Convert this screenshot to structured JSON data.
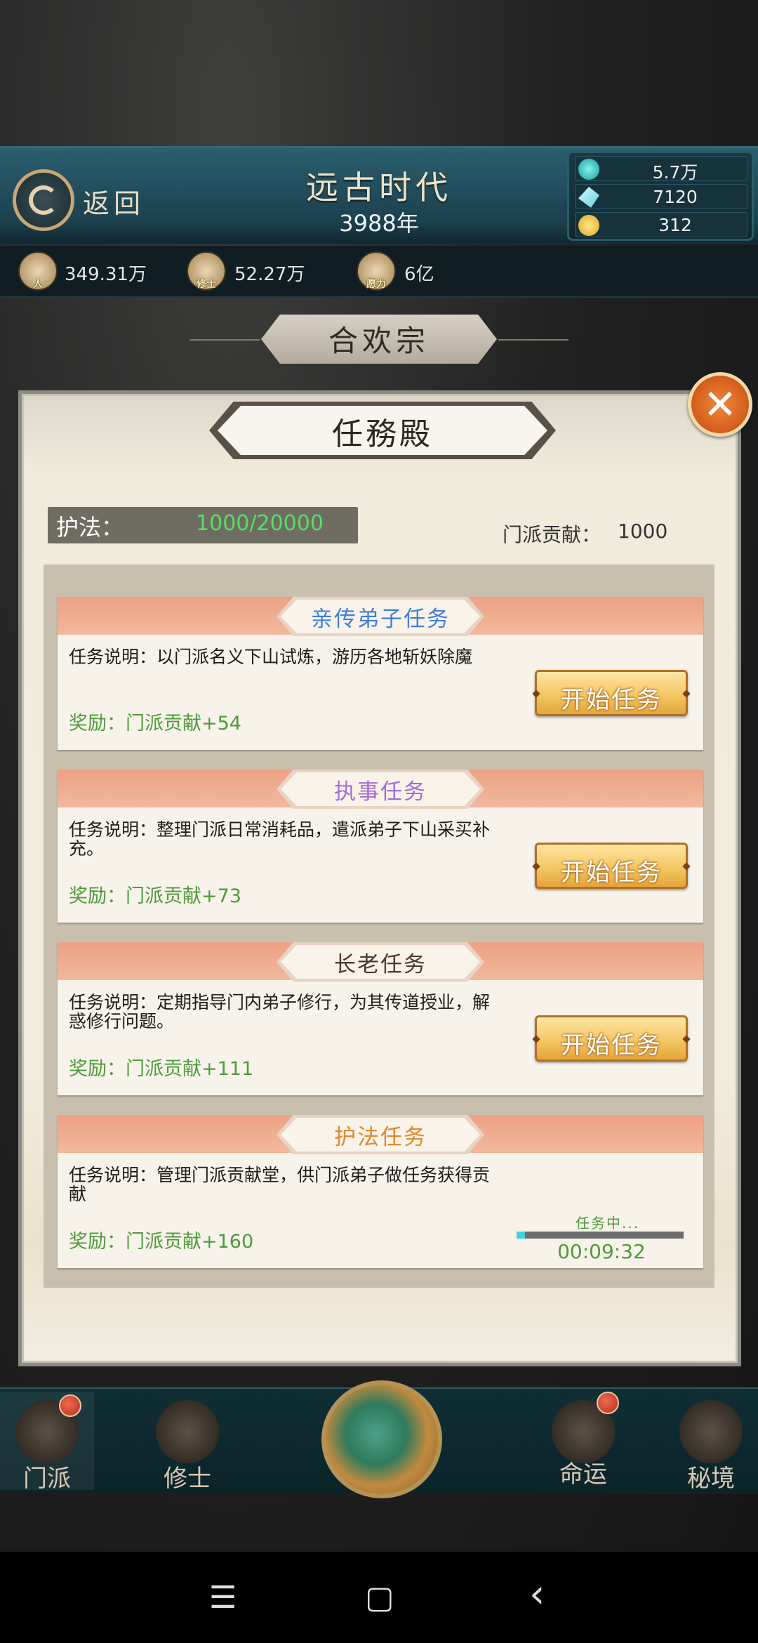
{
  "header": {
    "back_label": "返回",
    "era_title": "远古时代",
    "era_year": "3988年"
  },
  "resources": [
    {
      "icon": "jade-orb-icon",
      "value": "5.7万",
      "color": "#2fc6c4"
    },
    {
      "icon": "crystal-icon",
      "value": "7120",
      "color": "#8fe6f0"
    },
    {
      "icon": "gold-ingot-icon",
      "value": "312",
      "color": "#f4c440"
    }
  ],
  "stats": [
    {
      "icon": "population-icon",
      "tag": "人",
      "value": "349.31万"
    },
    {
      "icon": "cultivator-icon",
      "tag": "修士",
      "value": "52.27万"
    },
    {
      "icon": "wish-power-icon",
      "tag": "愿力",
      "value": "6亿"
    }
  ],
  "sect_name": "合欢宗",
  "panel": {
    "title": "任務殿",
    "guard_label": "护法：",
    "guard_value": "1000/20000",
    "contribution_label": "门派贡献：",
    "contribution_value": "1000"
  },
  "tasks": [
    {
      "name": "亲传弟子任务",
      "name_color": "#3f7fd8",
      "desc": "任务说明：以门派名义下山试炼，游历各地斩妖除魔",
      "reward": "奖励：门派贡献+54",
      "button": "开始任务"
    },
    {
      "name": "执事任务",
      "name_color": "#a46ad8",
      "desc": "任务说明：整理门派日常消耗品，遣派弟子下山采买补充。",
      "reward": "奖励：门派贡献+73",
      "button": "开始任务"
    },
    {
      "name": "长老任务",
      "name_color": "#4a3a2e",
      "desc": "任务说明：定期指导门内弟子修行，为其传道授业，解惑修行问题。",
      "reward": "奖励：门派贡献+111",
      "button": "开始任务"
    },
    {
      "name": "护法任务",
      "name_color": "#e08a2e",
      "desc": "任务说明：管理门派贡献堂，供门派弟子做任务获得贡献",
      "reward": "奖励：门派贡献+160",
      "status": "任务中...",
      "timer": "00:09:32",
      "progress": 0.05
    }
  ],
  "bottom_nav": [
    {
      "label": "门派",
      "icon": "sect-icon",
      "badge": true
    },
    {
      "label": "修士",
      "icon": "cultivator-icon",
      "badge": false
    },
    {
      "label": "",
      "icon": "world-orb-icon",
      "badge": false
    },
    {
      "label": "命运",
      "icon": "fate-icon",
      "badge": true
    },
    {
      "label": "秘境",
      "icon": "secret-realm-icon",
      "badge": false
    }
  ],
  "system_nav": {
    "menu": "☰",
    "home": "▢",
    "back": "‹"
  }
}
